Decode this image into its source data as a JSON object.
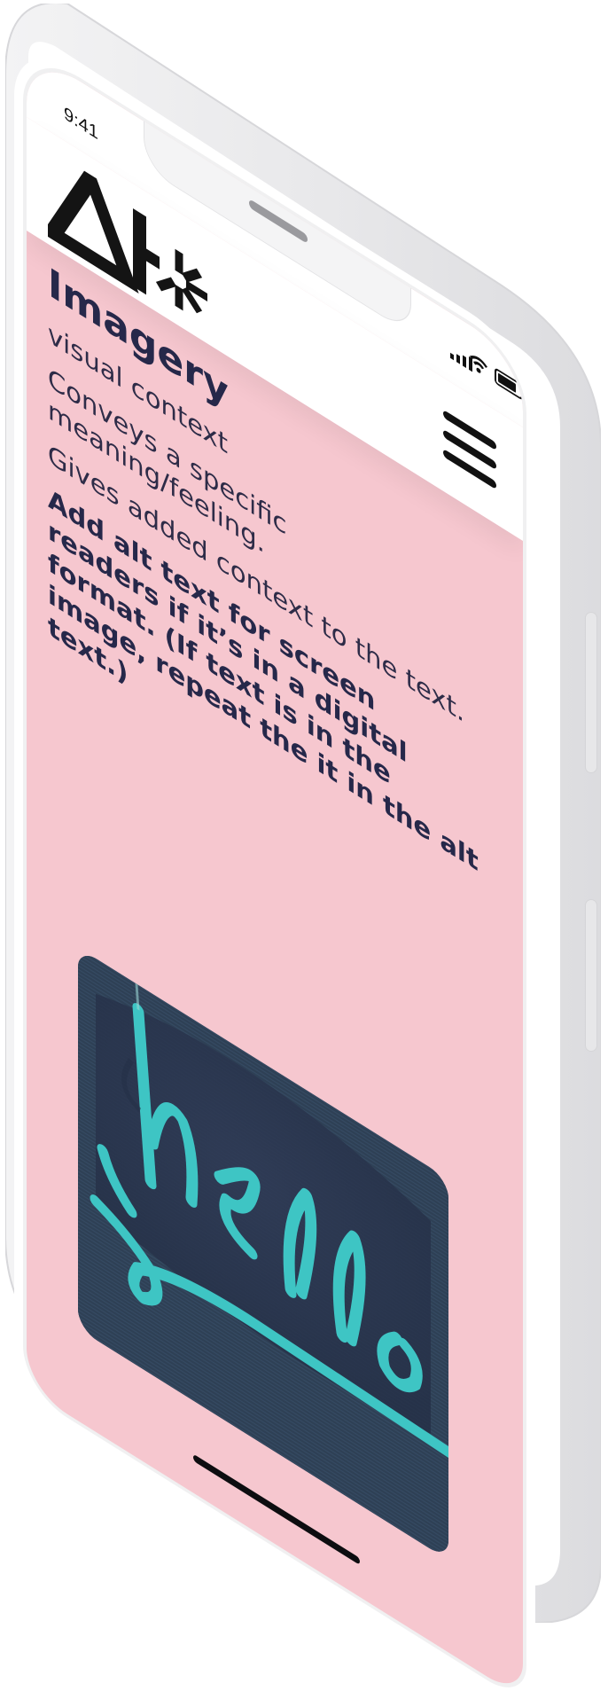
{
  "status_bar": {
    "time": "9:41"
  },
  "header": {
    "logo_icon": "ah-logo-icon",
    "menu_icon": "hamburger-menu-icon"
  },
  "content": {
    "heading": "Imagery",
    "paragraphs": [
      "visual context",
      "Conveys a specific meaning/feeling.",
      "Gives added context to the text."
    ],
    "strong_paragraph": "Add alt text for screen readers if it’s in a digital format. (If text is in the image, repeat the it in the alt text.)"
  },
  "image": {
    "icon": "hello-neon-sign-icon"
  },
  "colors": {
    "page_background": "#f6c7cf",
    "header_background": "#ffffff",
    "text_primary": "#26284a",
    "neon_teal": "#3ec5c4",
    "image_background": "#2b3d53"
  }
}
